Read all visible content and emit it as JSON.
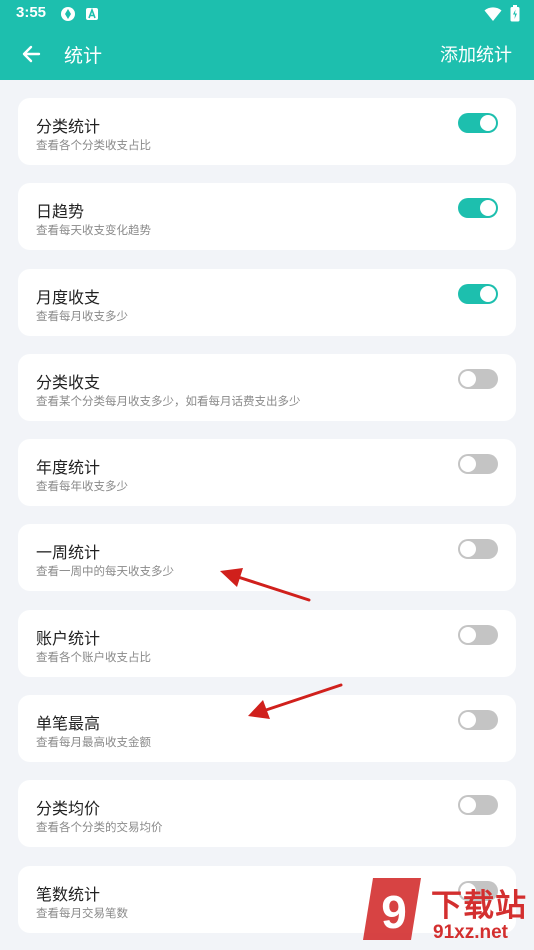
{
  "status_bar": {
    "time": "3:55"
  },
  "app_bar": {
    "title": "统计",
    "action": "添加统计"
  },
  "items": [
    {
      "title": "分类统计",
      "subtitle": "查看各个分类收支占比",
      "enabled": true
    },
    {
      "title": "日趋势",
      "subtitle": "查看每天收支变化趋势",
      "enabled": true
    },
    {
      "title": "月度收支",
      "subtitle": "查看每月收支多少",
      "enabled": true
    },
    {
      "title": "分类收支",
      "subtitle": "查看某个分类每月收支多少，如看每月话费支出多少",
      "enabled": false
    },
    {
      "title": "年度统计",
      "subtitle": "查看每年收支多少",
      "enabled": false
    },
    {
      "title": "一周统计",
      "subtitle": "查看一周中的每天收支多少",
      "enabled": false
    },
    {
      "title": "账户统计",
      "subtitle": "查看各个账户收支占比",
      "enabled": false
    },
    {
      "title": "单笔最高",
      "subtitle": "查看每月最高收支金额",
      "enabled": false
    },
    {
      "title": "分类均价",
      "subtitle": "查看各个分类的交易均价",
      "enabled": false
    },
    {
      "title": "笔数统计",
      "subtitle": "查看每月交易笔数",
      "enabled": false
    }
  ],
  "watermark": {
    "text": "下载站",
    "domain": "91xz.net",
    "logo_glyph": "9"
  },
  "colors": {
    "accent": "#1dbfae",
    "toggle_off": "#c4c4c4",
    "background": "#f2f4f8",
    "arrow": "#d0201c"
  },
  "icons": {
    "back": "arrow-left-icon",
    "wifi": "wifi-icon",
    "battery": "battery-icon"
  }
}
